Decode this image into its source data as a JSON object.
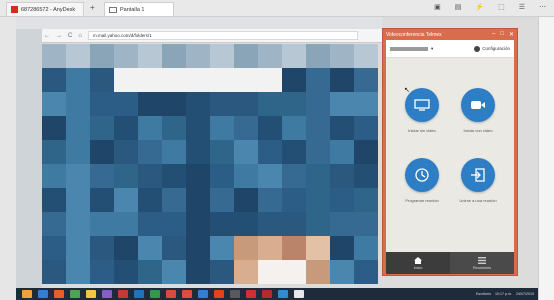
{
  "anydesk": {
    "tab1_label": "687286572 - AnyDesk",
    "tab2_label": "Pantalla 1",
    "new_tab_symbol": "+",
    "tools": [
      "▣",
      "▤",
      "⚡",
      "⬚",
      "☰",
      "⋯"
    ]
  },
  "browser": {
    "url": "m.mail.yahoo.com/d/folders/1",
    "nav_icons": [
      "←",
      "→",
      "C",
      "⌂"
    ]
  },
  "app": {
    "title": "Videoconferencia Telmex",
    "win_controls": [
      "–",
      "□",
      "✕"
    ],
    "header": {
      "account_caret": "▾",
      "config_label": "Configuración"
    },
    "actions": [
      {
        "label": "Iniciar sin video",
        "icon": "screen-share-icon"
      },
      {
        "label": "Iniciar con video",
        "icon": "video-camera-icon"
      },
      {
        "label": "Programar reunión",
        "icon": "clock-icon"
      },
      {
        "label": "Unirse a una reunión",
        "icon": "enter-arrow-icon"
      }
    ],
    "footer": [
      {
        "label": "Inicio",
        "icon": "home-icon"
      },
      {
        "label": "Reuniones",
        "icon": "list-icon"
      }
    ],
    "colors": {
      "accent": "#2e7ec6",
      "frame": "#d76d4a"
    }
  },
  "taskbar": {
    "tray_text": "Escritorio",
    "time": "10:17 p.m.",
    "date": "24/07/2019",
    "icon_colors": [
      "#f0a33b",
      "#2f7ed8",
      "#e95d2a",
      "#4ca64c",
      "#f5c542",
      "#8a5cc8",
      "#c43b2e",
      "#1e73be",
      "#2e9c4a",
      "#d94b3b",
      "#e34c3c",
      "#2f7ed8",
      "#e7411e",
      "#5a5a5a",
      "#d0302f",
      "#b52b2b",
      "#2e8bd8",
      "#e8e8e8"
    ]
  }
}
